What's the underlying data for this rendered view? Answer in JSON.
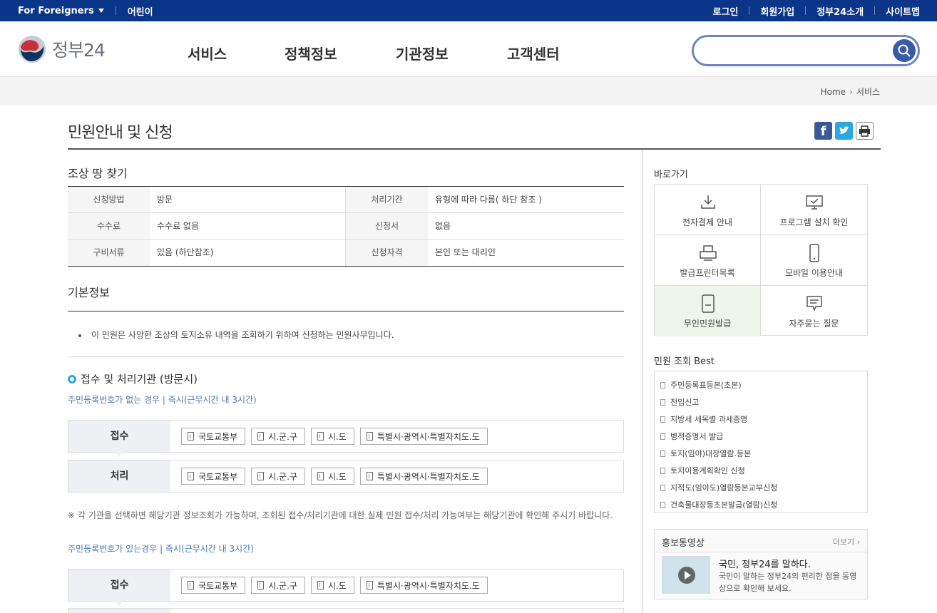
{
  "topbar": {
    "foreigners": "For Foreigners",
    "kids": "어린이",
    "links": [
      "로그인",
      "회원가입",
      "정부24소개",
      "사이트맵"
    ]
  },
  "header": {
    "logo_text": "정부24",
    "nav": [
      "서비스",
      "정책정보",
      "기관정보",
      "고객센터"
    ],
    "search_placeholder": ""
  },
  "breadcrumb": {
    "home": "Home",
    "current": "서비스"
  },
  "page": {
    "title": "민원안내 및 신청",
    "section_title": "조상 땅 찾기",
    "info_rows": [
      {
        "k1": "신청방법",
        "v1": "방문",
        "k2": "처리기간",
        "v2": "유형에 따라 다름( 하단 참조 )"
      },
      {
        "k1": "수수료",
        "v1": "수수료 없음",
        "k2": "신청서",
        "v2": "없음"
      },
      {
        "k1": "구비서류",
        "v1": "있음 (하단참조)",
        "k2": "신청자격",
        "v2": "본인 또는 대리인"
      }
    ],
    "basic_title": "기본정보",
    "basic_bullet": "이 민원은 사망한 조상의 토지소유 내역을 조회하기 위하여 신청하는 민원사무입니다.",
    "reception_title": "접수 및 처리기관 (방문시)",
    "case1": "주민등록번호가 없는 경우 | 즉시(근무시간 내 3시간)",
    "case2": "주민등록번호가 있는경우 | 즉시(근무시간 내 3시간)",
    "label_receive": "접수",
    "label_process": "처리",
    "orgs": [
      "국토교통부",
      "시.군.구",
      "시.도",
      "특별시·광역시·특별자치도.도"
    ],
    "note": "※ 각 기관을 선택하면 해당기관 정보조회가 가능하며, 조회된 접수/처리기관에 대한 실제 민원 접수/처리 가능여부는 해당기관에 확인해 주시기 바랍니다."
  },
  "sidebar": {
    "quick_title": "바로가기",
    "quick": [
      {
        "label": "전자결제 안내",
        "icon": "download-icon"
      },
      {
        "label": "프로그램 설치 확인",
        "icon": "monitor-check-icon"
      },
      {
        "label": "발급프린터목록",
        "icon": "printer-icon"
      },
      {
        "label": "모바일 이용안내",
        "icon": "mobile-icon"
      },
      {
        "label": "무인민원발급",
        "icon": "kiosk-icon"
      },
      {
        "label": "자주묻는 질문",
        "icon": "chat-icon"
      }
    ],
    "best_title": "민원 조회 Best",
    "best": [
      "주민등록표등본(초본)",
      "전입신고",
      "지방세 세목별 과세증명",
      "병적증명서 발급",
      "토지(임야)대장열람.등본",
      "토지이용계획확인 신청",
      "지적도(임야도)열람등본교부신청",
      "건축물대장등초본발급(열람)신청"
    ],
    "promo_title": "홍보동영상",
    "promo_more": "더보기",
    "promo_video_title": "국민, 정부24를 말하다.",
    "promo_video_desc": "국민이 말하는 정부24의 편리한 점을 동영상으로 확인해 보세요."
  },
  "colors": {
    "topbar": "#0b3588",
    "accent": "#2aa8e0",
    "active_cell": "#eef6ea"
  }
}
